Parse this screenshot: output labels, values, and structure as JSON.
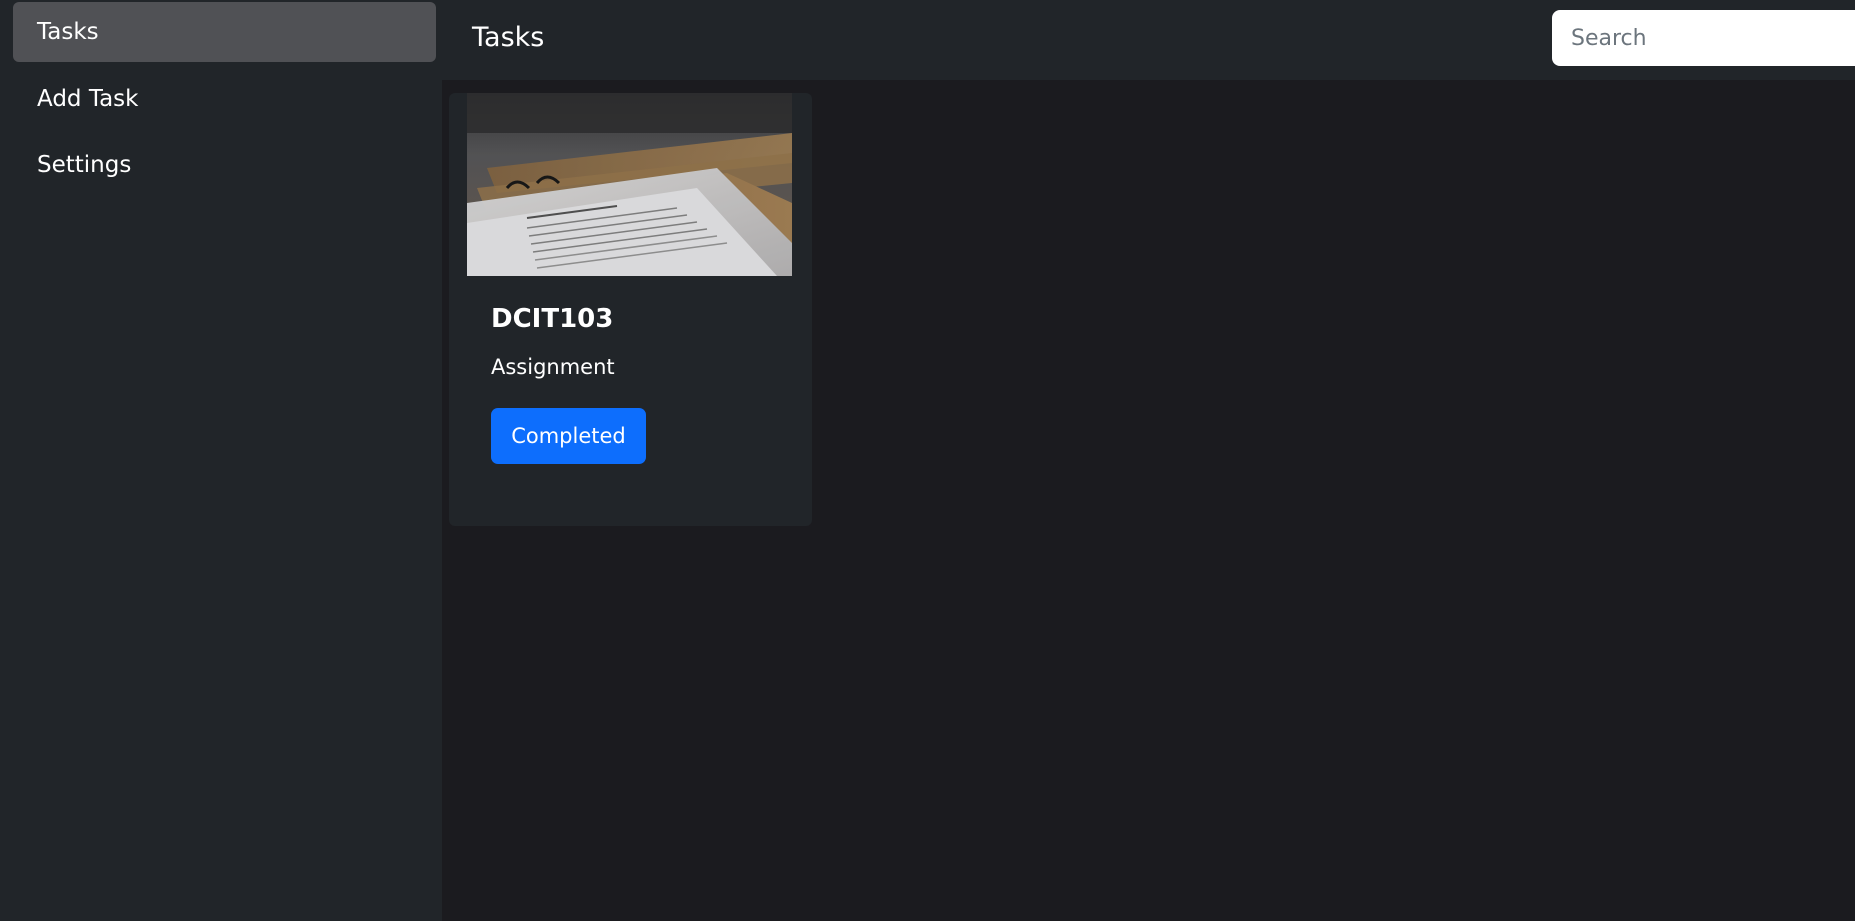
{
  "sidebar": {
    "items": [
      {
        "label": "Tasks",
        "active": true
      },
      {
        "label": "Add Task",
        "active": false
      },
      {
        "label": "Settings",
        "active": false
      }
    ]
  },
  "header": {
    "title": "Tasks",
    "search_placeholder": "Search"
  },
  "tasks": [
    {
      "title": "DCIT103",
      "type": "Assignment",
      "status": "Completed",
      "image": "paper-documents-photo"
    }
  ],
  "colors": {
    "sidebar_bg": "#212529",
    "main_bg": "#1b1b1f",
    "active_item_bg": "#505155",
    "accent": "#0d6efd"
  }
}
